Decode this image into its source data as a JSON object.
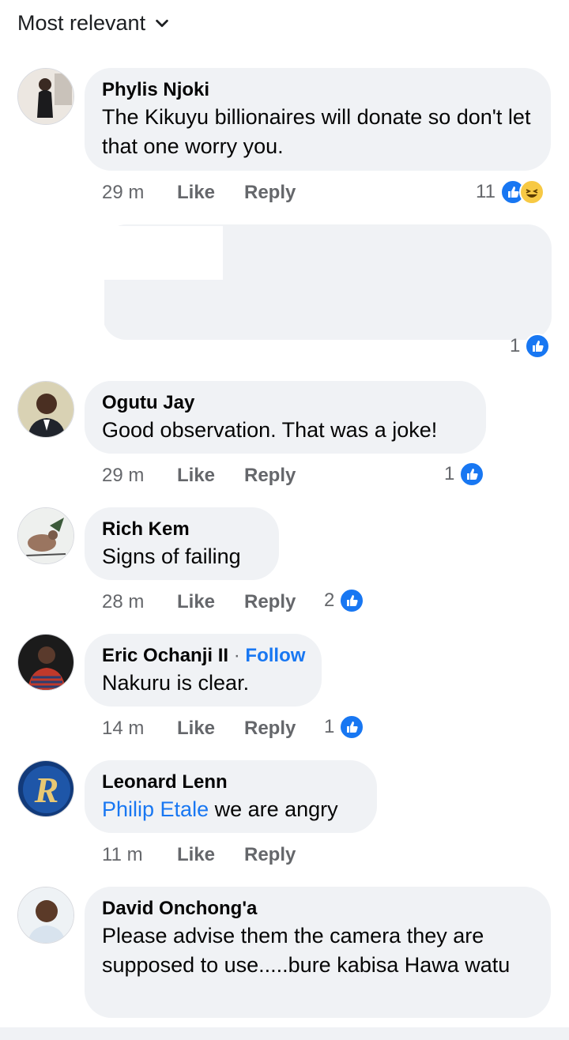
{
  "sort": {
    "label": "Most relevant"
  },
  "comments": [
    {
      "name": "Phylis Njoki",
      "text": "The  Kikuyu billionaires will donate so don't let that one worry you.",
      "time": "29 m",
      "like": "Like",
      "reply": "Reply",
      "reactions": "11",
      "reaction_icons": [
        "like-icon",
        "haha-icon"
      ]
    },
    {
      "reactions": "1",
      "reaction_icons": [
        "like-icon"
      ]
    },
    {
      "name": "Ogutu Jay",
      "text": "Good observation. That was a joke!",
      "time": "29 m",
      "like": "Like",
      "reply": "Reply",
      "reactions": "1",
      "reaction_icons": [
        "like-icon"
      ]
    },
    {
      "name": "Rich Kem",
      "text": "Signs of failing",
      "time": "28 m",
      "like": "Like",
      "reply": "Reply",
      "reactions": "2",
      "reaction_icons": [
        "like-icon"
      ]
    },
    {
      "name": "Eric Ochanji II",
      "separator": "·",
      "follow": "Follow",
      "text": "Nakuru is clear.",
      "time": "14 m",
      "like": "Like",
      "reply": "Reply",
      "reactions": "1",
      "reaction_icons": [
        "like-icon"
      ]
    },
    {
      "name": "Leonard Lenn",
      "mention": "Philip Etale",
      "text": " we are angry",
      "time": "11 m",
      "like": "Like",
      "reply": "Reply"
    },
    {
      "name": "David Onchong'a",
      "text": "Please advise them the camera they are supposed to use.....bure kabisa Hawa watu"
    }
  ],
  "colors": {
    "accent": "#1877f2",
    "bubble": "#f0f2f5",
    "muted": "#65676b",
    "haha": "#f7c944"
  }
}
